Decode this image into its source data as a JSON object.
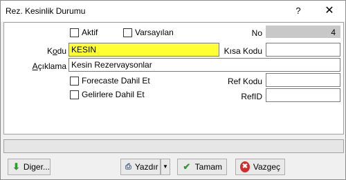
{
  "window": {
    "title": "Rez. Kesinlik Durumu",
    "help_label": "?",
    "close_label": "✕"
  },
  "form": {
    "aktif_label": "Aktif",
    "varsayilan_label": "Varsayılan",
    "no_label": "No",
    "no_value": "4",
    "kodu_label": "Kodu",
    "kodu_value": "KESIN",
    "kisa_kodu_label": "Kısa Kodu",
    "kisa_kodu_value": "",
    "aciklama_label": "Açıklama",
    "aciklama_value": "Kesin Rezervaysonlar",
    "forecaste_label": "Forecaste Dahil Et",
    "ref_kodu_label": "Ref Kodu",
    "ref_kodu_value": "",
    "gelirlere_label": "Gelirlere Dahil Et",
    "refid_label": "RefID",
    "refid_value": ""
  },
  "buttons": {
    "diger_label": "Diger...",
    "yazdir_label": "Yazdır",
    "tamam_label": "Tamam",
    "vazgec_label": "Vazgeç"
  },
  "colors": {
    "kodu_highlight": "#ffff33",
    "readonly_field": "#c8c8c8"
  }
}
